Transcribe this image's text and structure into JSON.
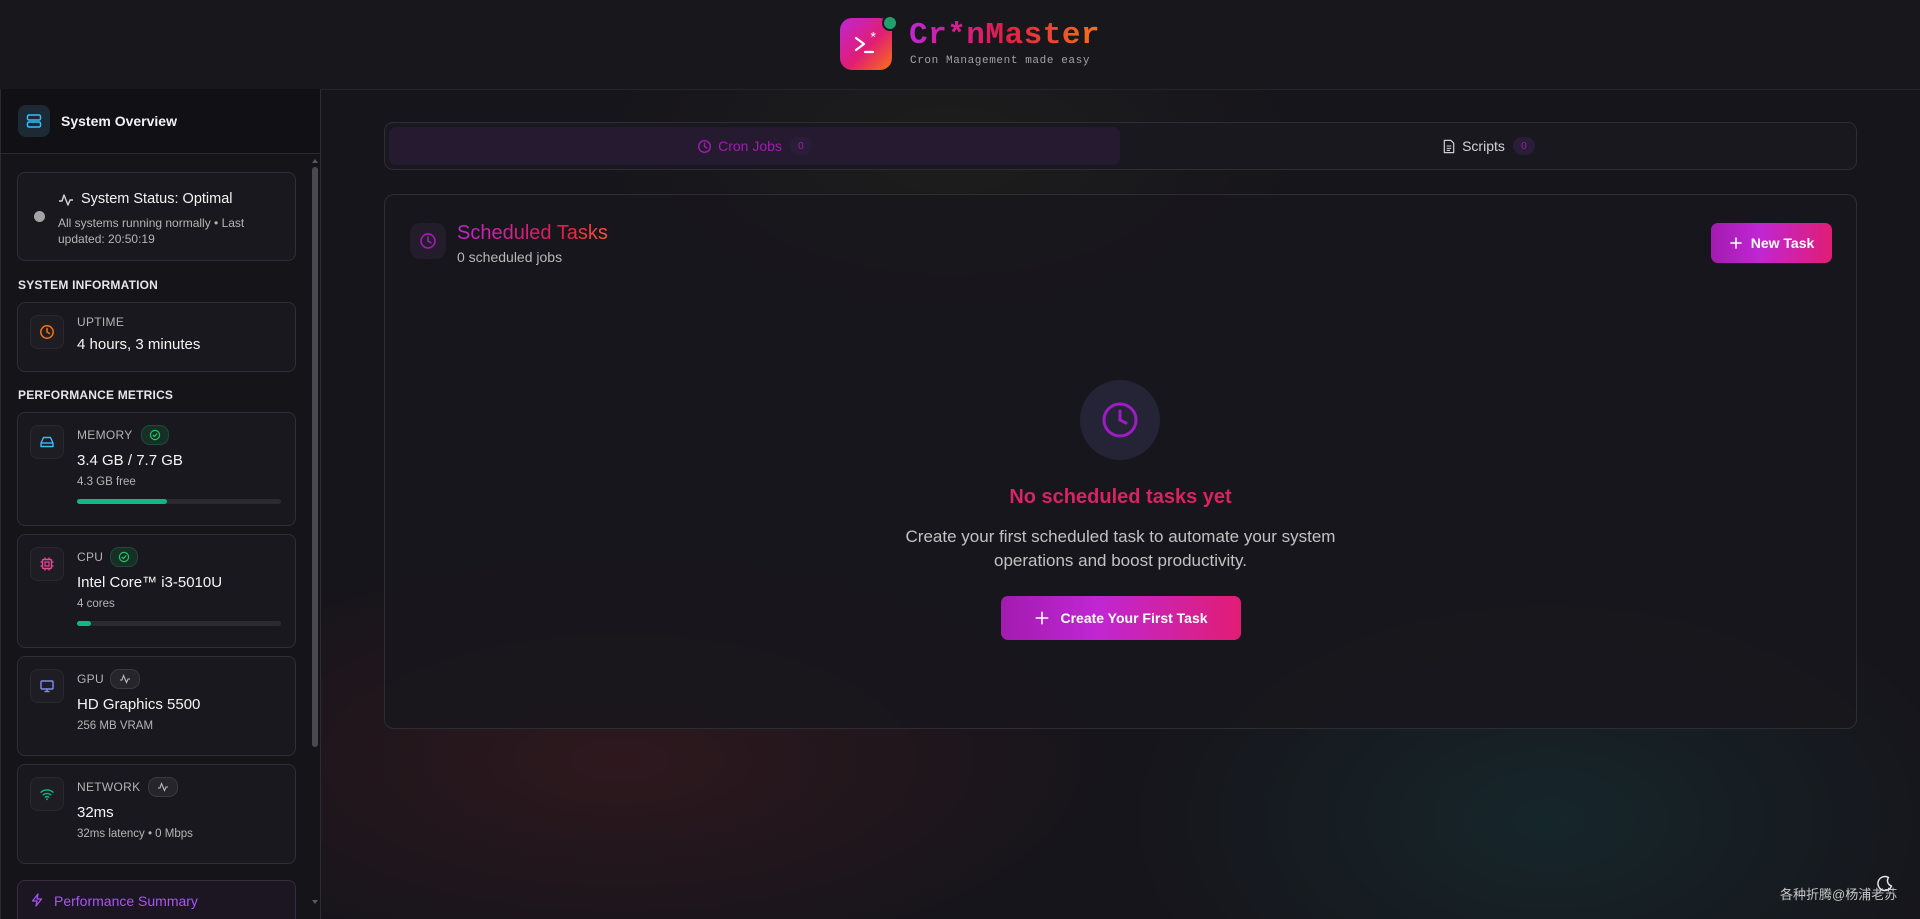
{
  "header": {
    "brand": "Cr*nMaster",
    "tagline": "Cron Management made easy"
  },
  "sidebar": {
    "title": "System Overview",
    "status": {
      "title": "System Status: Optimal",
      "detail": "All systems running normally • Last updated: 20:50:19"
    },
    "system_info_label": "SYSTEM INFORMATION",
    "uptime": {
      "label": "UPTIME",
      "value": "4 hours, 3 minutes"
    },
    "performance_label": "PERFORMANCE METRICS",
    "memory": {
      "label": "MEMORY",
      "value": "3.4 GB / 7.7 GB",
      "sub": "4.3 GB free",
      "usage_fraction": 0.44
    },
    "cpu": {
      "label": "CPU",
      "value": "Intel Core™ i3-5010U",
      "sub": "4 cores",
      "usage_fraction": 0.07
    },
    "gpu": {
      "label": "GPU",
      "value": "HD Graphics 5500",
      "sub": "256 MB VRAM"
    },
    "network": {
      "label": "NETWORK",
      "value": "32ms",
      "sub": "32ms latency • 0 Mbps"
    },
    "summary": {
      "label": "Performance Summary"
    }
  },
  "tabs": [
    {
      "label": "Cron Jobs",
      "count": "0",
      "active": true
    },
    {
      "label": "Scripts",
      "count": "0",
      "active": false
    }
  ],
  "panel": {
    "title": "Scheduled Tasks",
    "subtitle": "0 scheduled jobs",
    "new_button": "New Task",
    "empty_title": "No scheduled tasks yet",
    "empty_desc": "Create your first scheduled task to automate your system operations and boost productivity.",
    "create_button": "Create Your First Task"
  },
  "footer": {
    "watermark": "各种折腾@杨浦老苏"
  },
  "colors": {
    "accent": "#c026d3",
    "accent2": "#e11d74",
    "ok": "#10b981"
  }
}
